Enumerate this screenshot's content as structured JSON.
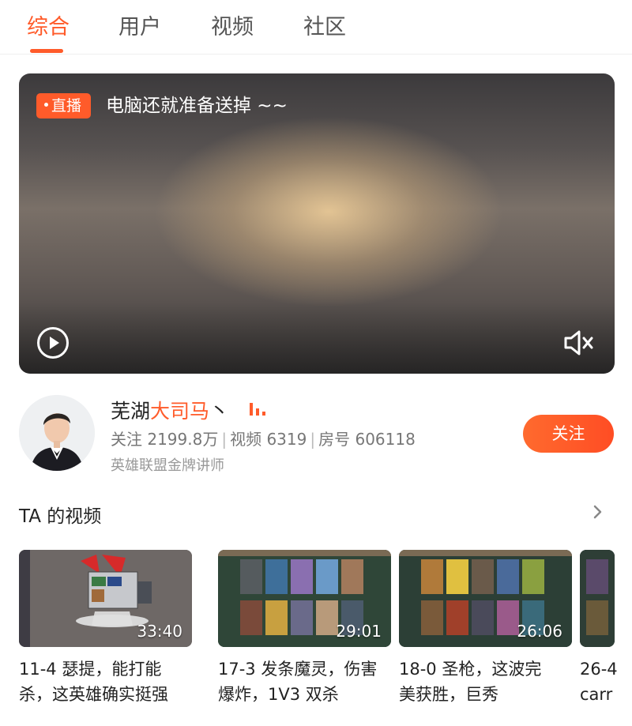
{
  "tabs": [
    {
      "label": "综合",
      "active": true
    },
    {
      "label": "用户",
      "active": false
    },
    {
      "label": "视频",
      "active": false
    },
    {
      "label": "社区",
      "active": false
    }
  ],
  "live": {
    "badge": "直播",
    "title": "电脑还就准备送掉 ~~",
    "play_icon": "play-circle-icon",
    "mute_icon": "speaker-muted-icon"
  },
  "streamer": {
    "name_prefix": "芜湖",
    "name_highlight": "大司马",
    "name_suffix": "丶",
    "stats_followers": "关注 2199.8万",
    "stats_videos": "视频 6319",
    "stats_room": "房号 606118",
    "separator": "|",
    "tagline": "英雄联盟金牌讲师",
    "follow_label": "关注",
    "live_icon": "live-bars-icon"
  },
  "videos_section": {
    "title": "TA 的视频",
    "more_icon": "chevron-right-icon",
    "items": [
      {
        "duration": "33:40",
        "title": "11-4 瑟提，能打能\n杀，这英雄确实挺强"
      },
      {
        "duration": "29:01",
        "title": "17-3 发条魔灵，伤害\n爆炸，1V3 双杀"
      },
      {
        "duration": "26:06",
        "title": "18-0 圣枪，这波完\n美获胜，巨秀"
      },
      {
        "duration": "",
        "title": "26-4\ncarr"
      }
    ]
  },
  "colors": {
    "accent": "#ff5b2a",
    "text": "#222222",
    "muted": "#777777"
  }
}
